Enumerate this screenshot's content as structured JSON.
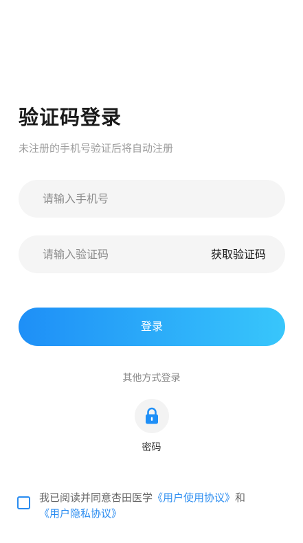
{
  "header": {
    "title": "验证码登录",
    "subtitle": "未注册的手机号验证后将自动注册"
  },
  "form": {
    "phone_placeholder": "请输入手机号",
    "code_placeholder": "请输入验证码",
    "get_code_label": "获取验证码",
    "login_label": "登录"
  },
  "other_login": {
    "title": "其他方式登录",
    "password_label": "密码",
    "password_icon": "lock-icon"
  },
  "agreement": {
    "text": "我已阅读并同意杏田医学",
    "user_agreement": "《用户使用协议》",
    "and": "和",
    "privacy_agreement": "《用户隐私协议》"
  },
  "colors": {
    "accent": "#2a8cf0",
    "gradient_start": "#1e8ff7",
    "gradient_end": "#38c6fb"
  }
}
